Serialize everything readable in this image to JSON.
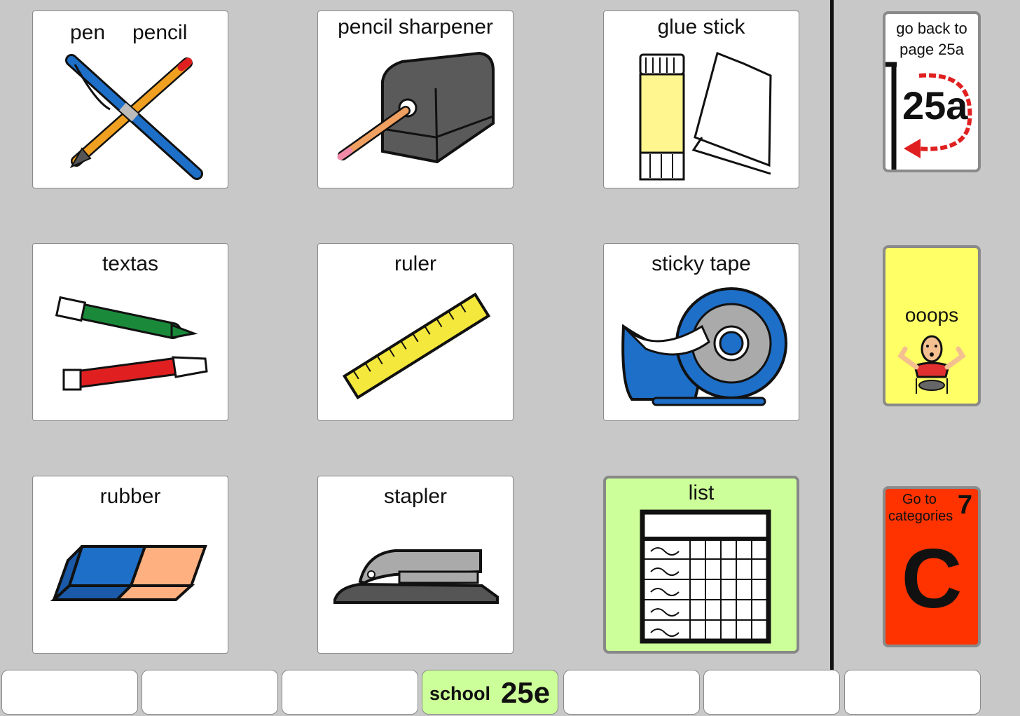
{
  "grid": {
    "pen_label": "pen",
    "pencil_label": "pencil",
    "sharpener_label": "pencil sharpener",
    "glue_label": "glue stick",
    "textas_label": "textas",
    "ruler_label": "ruler",
    "tape_label": "sticky tape",
    "rubber_label": "rubber",
    "stapler_label": "stapler",
    "list_label": "list"
  },
  "side": {
    "back_line1": "go back to",
    "back_line2": "page 25a",
    "back_page": "25a",
    "oops_label": "ooops",
    "categories_line1": "Go to",
    "categories_line2": "categories",
    "categories_number": "7",
    "categories_letter": "C"
  },
  "footer": {
    "page_name": "school",
    "page_number": "25e"
  },
  "colors": {
    "background": "#c8c8c8",
    "page_green": "#ccff99",
    "oops_yellow": "#ffff66",
    "categories_orange": "#ff3300"
  }
}
